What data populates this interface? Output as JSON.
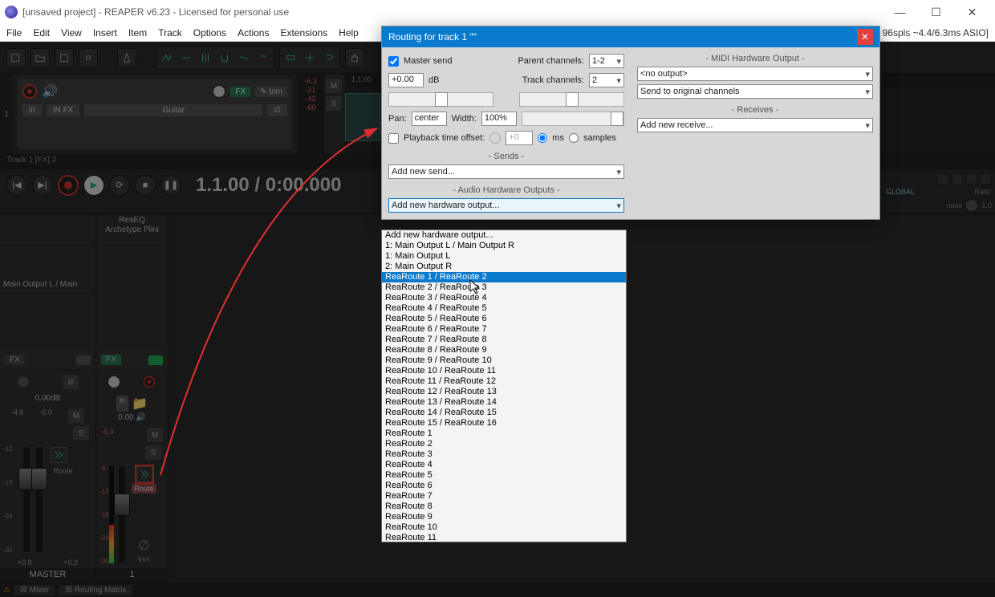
{
  "window": {
    "title": "[unsaved project] - REAPER v6.23 - Licensed for personal use",
    "status": "96spls ~4.4/6.3ms ASIO]"
  },
  "menu": [
    "File",
    "Edit",
    "View",
    "Insert",
    "Item",
    "Track",
    "Options",
    "Actions",
    "Extensions",
    "Help"
  ],
  "track": {
    "num": "1",
    "fx_label": "FX",
    "trim_label": "✎ trim",
    "in_label": "in",
    "infx_label": "IN FX",
    "name": "Guitar",
    "peak": "-6.3",
    "meter_vals": [
      "-21",
      "-42",
      "-60"
    ],
    "status": "Track 1 [FX] 2"
  },
  "ruler": "1.1.00",
  "transport": {
    "time": "1.1.00 / 0:00.000"
  },
  "mixer": {
    "master": {
      "out": "Main Output L / Main",
      "fx": "FX",
      "db": "0.00dB",
      "peaks": [
        "-4.6",
        "-5.0"
      ],
      "scale": [
        "-12",
        "-18",
        "-24",
        "-30"
      ],
      "btm": [
        "+0.9",
        "+0.2"
      ],
      "name": "MASTER",
      "route": "Route"
    },
    "track": {
      "plugs": [
        "ReaEQ",
        "Archetype Plini"
      ],
      "fx": "FX",
      "in": "in",
      "db": "0.00",
      "peak": "-6.3",
      "scale": [
        "-6",
        "-12",
        "-18",
        "-24",
        "-30"
      ],
      "trim": "trim",
      "name": "1",
      "route": "Route"
    }
  },
  "bottom_tabs": {
    "mixer": "Mixer",
    "routing": "Routing Matrix"
  },
  "right": {
    "global": "GLOBAL",
    "none": "none",
    "rate": "Rate:",
    "rateval": "1.0"
  },
  "dialog": {
    "title": "Routing for track 1 \"\"",
    "master_send": "Master send",
    "vol": "+0.00",
    "vol_unit": "dB",
    "parent_ch": "Parent channels:",
    "parent_val": "1-2",
    "track_ch": "Track channels:",
    "track_val": "2",
    "pan": "Pan:",
    "pan_val": "center",
    "width": "Width:",
    "width_val": "100%",
    "pto": "Playback time offset:",
    "pto_val": "+0",
    "ms": "ms",
    "samples": "samples",
    "sends_head": "-  Sends  -",
    "add_send": "Add new send...",
    "hw_head": "-  Audio Hardware Outputs  -",
    "add_hw": "Add new hardware output...",
    "midi_head": "-  MIDI Hardware Output  -",
    "midi_out": "<no output>",
    "midi_ch": "Send to original channels",
    "recv_head": "-  Receives  -",
    "add_recv": "Add new receive..."
  },
  "dropdown": {
    "selected_index": 4,
    "items": [
      "Add new hardware output...",
      "1: Main Output L / Main Output R",
      "1: Main Output L",
      "2: Main Output R",
      "ReaRoute 1 / ReaRoute 2",
      "ReaRoute 2 / ReaRoute 3",
      "ReaRoute 3 / ReaRoute 4",
      "ReaRoute 4 / ReaRoute 5",
      "ReaRoute 5 / ReaRoute 6",
      "ReaRoute 6 / ReaRoute 7",
      "ReaRoute 7 / ReaRoute 8",
      "ReaRoute 8 / ReaRoute 9",
      "ReaRoute 9 / ReaRoute 10",
      "ReaRoute 10 / ReaRoute 11",
      "ReaRoute 11 / ReaRoute 12",
      "ReaRoute 12 / ReaRoute 13",
      "ReaRoute 13 / ReaRoute 14",
      "ReaRoute 14 / ReaRoute 15",
      "ReaRoute 15 / ReaRoute 16",
      "ReaRoute 1",
      "ReaRoute 2",
      "ReaRoute 3",
      "ReaRoute 4",
      "ReaRoute 5",
      "ReaRoute 6",
      "ReaRoute 7",
      "ReaRoute 8",
      "ReaRoute 9",
      "ReaRoute 10",
      "ReaRoute 11"
    ]
  }
}
